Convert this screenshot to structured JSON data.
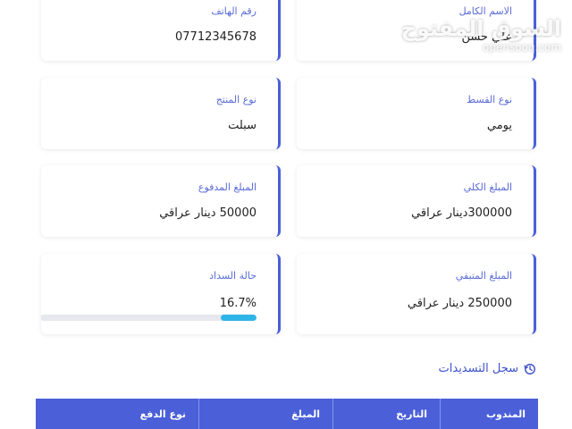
{
  "fields": {
    "full_name": {
      "label": "الاسم الكامل",
      "value": "علي حسن"
    },
    "phone": {
      "label": "رقم الهاتف",
      "value": "07712345678"
    },
    "installment_type": {
      "label": "نوع القسط",
      "value": "يومي"
    },
    "product_type": {
      "label": "نوع المنتج",
      "value": "سبلت"
    },
    "total_amount": {
      "label": "المبلغ الكلي",
      "value": "300000دينار عراقي"
    },
    "paid_amount": {
      "label": "المبلغ المدفوع",
      "value": "50000 دينار عراقي"
    },
    "remaining_amount": {
      "label": "المبلغ المتبقي",
      "value": "250000 دينار عراقي"
    },
    "payment_status": {
      "label": "حالة السداد",
      "percent_text": "16.7%",
      "progress": 0.167
    }
  },
  "history": {
    "title": "سجل التسديدات",
    "icon": "history-icon"
  },
  "table": {
    "headers": [
      "المندوب",
      "التاريخ",
      "المبلغ",
      "نوع الدفع"
    ]
  },
  "watermark": {
    "arabic": "السوق المفتوح",
    "latin": "opensooq.com"
  },
  "colors": {
    "accent": "#4a5fd8",
    "label": "#5a6bd6",
    "progress_fill": "#2fb4e8",
    "table_header": "#4a5fd8"
  }
}
